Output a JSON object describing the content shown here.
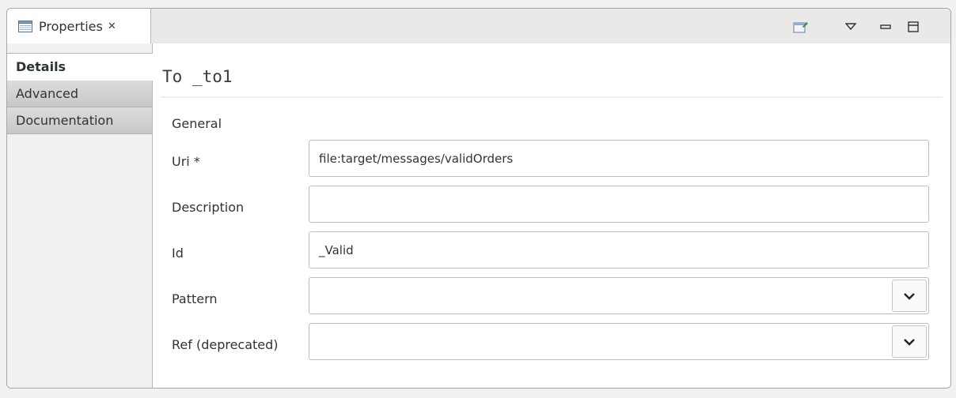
{
  "view": {
    "tab_title": "Properties",
    "tab_close_glyph": "✕",
    "toolbar_icons": [
      "pin-view-icon",
      "view-menu-icon",
      "minimize-icon",
      "maximize-icon"
    ]
  },
  "property_tabs": [
    {
      "label": "Details",
      "active": true
    },
    {
      "label": "Advanced",
      "active": false
    },
    {
      "label": "Documentation",
      "active": false
    }
  ],
  "details": {
    "title": "To _to1",
    "section": "General",
    "fields": {
      "uri": {
        "label": "Uri *",
        "value": "file:target/messages/validOrders"
      },
      "description": {
        "label": "Description",
        "value": ""
      },
      "id": {
        "label": "Id",
        "value": "_Valid"
      },
      "pattern": {
        "label": "Pattern",
        "value": ""
      },
      "ref": {
        "label": "Ref (deprecated)",
        "value": ""
      }
    }
  }
}
